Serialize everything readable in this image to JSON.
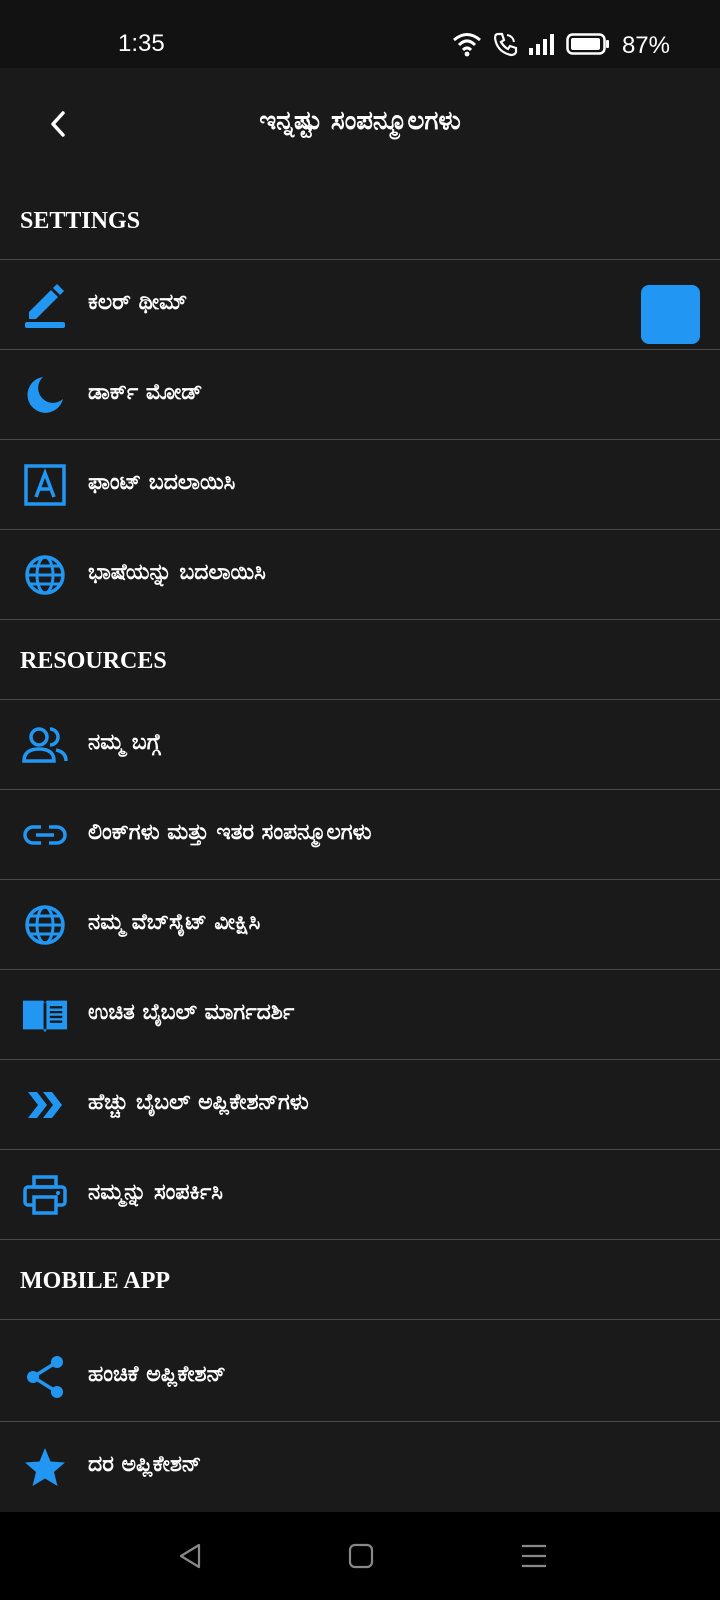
{
  "status_bar": {
    "time": "1:35",
    "battery": "87%",
    "icons": [
      "wifi-icon",
      "call-icon",
      "signal-icon",
      "battery-icon"
    ]
  },
  "app_bar": {
    "title": "ಇನ್ನಷ್ಟು ಸಂಪನ್ಮೂಲಗಳು",
    "back_icon": "back-icon"
  },
  "colors": {
    "accent": "#2196f3",
    "background": "#1a1a1a",
    "divider": "#4a4a4a",
    "theme_swatch": "#2196f3"
  },
  "sections": [
    {
      "header": "SETTINGS",
      "items": [
        {
          "label": "ಕಲರ್ ಥೀಮ್",
          "icon": "pencil-icon"
        },
        {
          "label": "ಡಾರ್ಕ್ ಮೋಡ್",
          "icon": "moon-icon"
        },
        {
          "label": "ಫಾಂಟ್ ಬದಲಾಯಿಸಿ",
          "icon": "font-icon"
        },
        {
          "label": "ಭಾಷೆಯನ್ನು ಬದಲಾಯಿಸಿ",
          "icon": "globe-icon"
        }
      ]
    },
    {
      "header": "RESOURCES",
      "items": [
        {
          "label": "ನಮ್ಮ ಬಗ್ಗೆ",
          "icon": "people-icon"
        },
        {
          "label": "ಲಿಂಕ್‌ಗಳು ಮತ್ತು ಇತರ ಸಂಪನ್ಮೂಲಗಳು",
          "icon": "link-icon"
        },
        {
          "label": "ನಮ್ಮ ವೆಬ್‌ಸೈಟ್ ವೀಕ್ಷಿಸಿ",
          "icon": "globe-icon"
        },
        {
          "label": "ಉಚಿತ ಬೈಬಲ್ ಮಾರ್ಗದರ್ಶಿ",
          "icon": "book-icon"
        },
        {
          "label": "ಹೆಚ್ಚು ಬೈಬಲ್ ಅಪ್ಲಿಕೇಶನ್‌ಗಳು",
          "icon": "double-chevron-icon"
        },
        {
          "label": "ನಮ್ಮನ್ನು ಸಂಪರ್ಕಿಸಿ",
          "icon": "printer-icon"
        }
      ]
    },
    {
      "header": "MOBILE APP",
      "items": [
        {
          "label": "ಹಂಚಿಕೆ ಅಪ್ಲಿಕೇಶನ್",
          "icon": "share-icon"
        },
        {
          "label": "ದರ ಅಪ್ಲಿಕೇಶನ್",
          "icon": "star-icon"
        }
      ]
    }
  ],
  "nav_bar": {
    "buttons": [
      "nav-back-icon",
      "nav-home-icon",
      "nav-menu-icon"
    ]
  }
}
